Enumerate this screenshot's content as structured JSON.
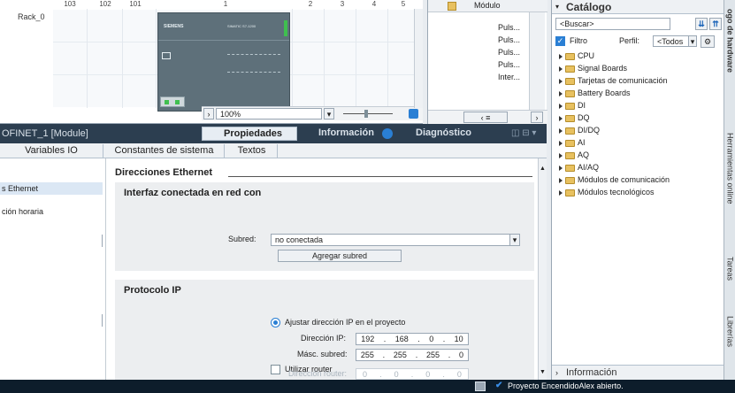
{
  "device_view": {
    "rack_label": "Rack_0",
    "slot_headers": [
      "103",
      "102",
      "101",
      "1",
      "2",
      "3",
      "4",
      "5"
    ],
    "plc_brand": "SIEMENS",
    "plc_model": "SIMATIC S7-1200",
    "zoom": "100%"
  },
  "module_table": {
    "header": "Módulo",
    "rows": [
      "Puls...",
      "Puls...",
      "Puls...",
      "Puls...",
      "Inter..."
    ]
  },
  "properties_bar": {
    "title": "OFINET_1 [Module]",
    "tab_properties": "Propiedades",
    "tab_info": "Información",
    "tab_diag": "Diagnóstico"
  },
  "sub_tabs": [
    "Variables IO",
    "Constantes de sistema",
    "Textos"
  ],
  "left_nav": [
    "s Ethernet",
    "ción horaria"
  ],
  "ethernet": {
    "heading": "Direcciones Ethernet",
    "iface_title": "Interfaz conectada en red con",
    "subnet_label": "Subred:",
    "subnet_value": "no conectada",
    "add_subnet": "Agregar subred",
    "ip_protocol": "Protocolo IP",
    "radio_label": "Ajustar dirección IP en el proyecto",
    "ip_label": "Dirección IP:",
    "ip_octets": [
      "192",
      "168",
      "0",
      "10"
    ],
    "mask_label": "Másc. subred:",
    "mask_octets": [
      "255",
      "255",
      "255",
      "0"
    ],
    "router_checkbox": "Utilizar router",
    "router_label": "Dirección router:",
    "router_octets": [
      "0",
      "0",
      "0",
      "0"
    ]
  },
  "catalog": {
    "title": "Catálogo",
    "search_placeholder": "<Buscar>",
    "filter_label": "Filtro",
    "profile_label": "Perfil:",
    "profile_value": "<Todos",
    "items": [
      "CPU",
      "Signal Boards",
      "Tarjetas de comunicación",
      "Battery Boards",
      "DI",
      "DQ",
      "DI/DQ",
      "AI",
      "AQ",
      "AI/AQ",
      "Módulos de comunicación",
      "Módulos tecnológicos"
    ],
    "info_section": "Información"
  },
  "side_tabs": [
    "ogo de hardware",
    "Herramientas online",
    "Tareas",
    "Librerías"
  ],
  "status_bar": {
    "message": "Proyecto EncendidoAlex abierto."
  },
  "colors": {
    "accent": "#1b64b8",
    "status_bg": "#0d1d2b",
    "plc_body": "#5e707a",
    "plc_led_green": "#3fbf4f"
  }
}
